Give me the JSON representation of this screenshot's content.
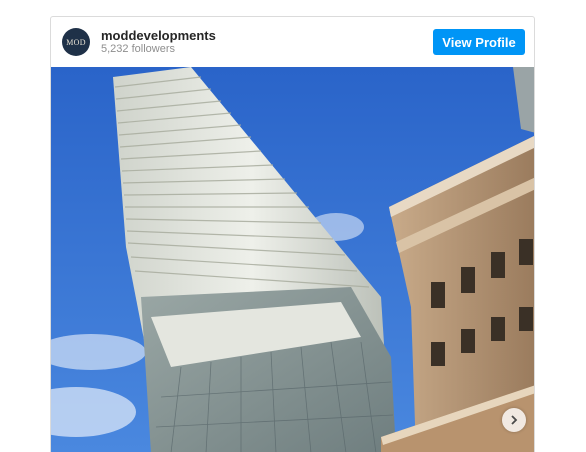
{
  "post": {
    "avatar_text": "MOD",
    "username": "moddevelopments",
    "followers": "5,232 followers",
    "view_profile_label": "View Profile",
    "image_subject": "low-angle view of a white-balconied glass skyscraper beside a brown stone building against a blue sky",
    "next_icon": "chevron-right-icon"
  },
  "colors": {
    "accent": "#0095f6",
    "sky": "#2f6fd1",
    "avatar_bg": "#1f3148"
  }
}
